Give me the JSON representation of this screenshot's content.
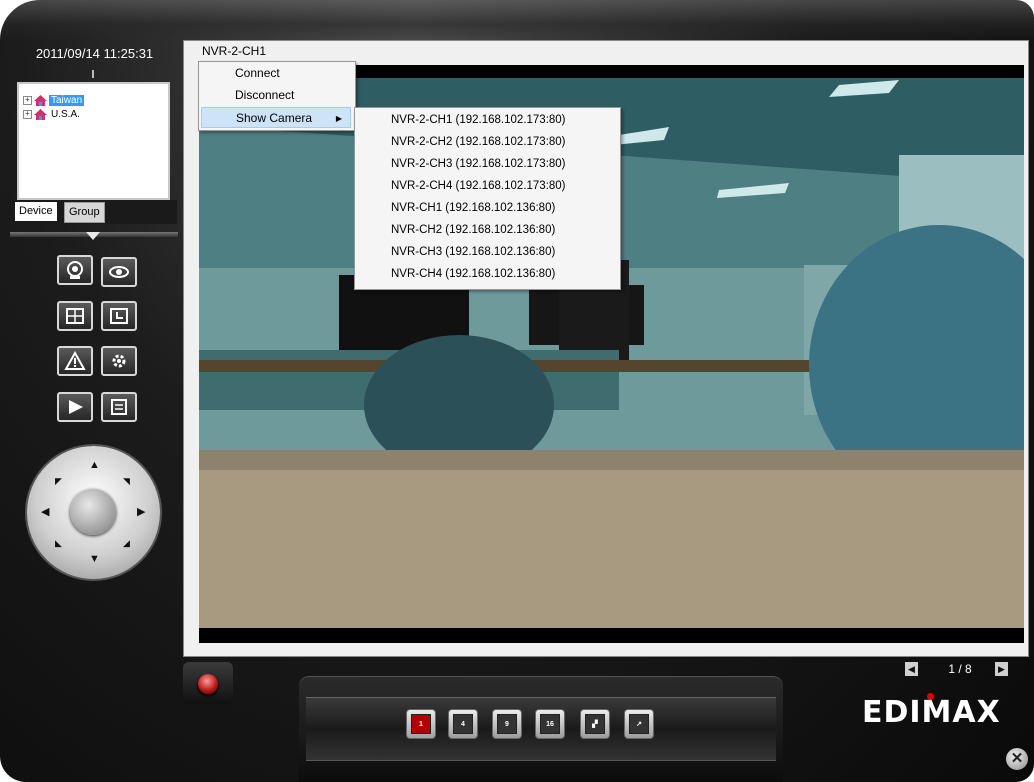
{
  "datetime": "2011/09/14 11:25:31",
  "tree": {
    "items": [
      {
        "label": "Taiwan",
        "selected": true
      },
      {
        "label": "U.S.A.",
        "selected": false
      }
    ]
  },
  "tabs": [
    "Device",
    "Group"
  ],
  "controls": {
    "buttons": [
      {
        "icon": "webcam-icon"
      },
      {
        "icon": "eye-icon"
      },
      {
        "icon": "layout-icon"
      },
      {
        "icon": "schedule-icon"
      },
      {
        "icon": "alert-icon"
      },
      {
        "icon": "settings-icon"
      },
      {
        "icon": "play-icon"
      },
      {
        "icon": "log-icon"
      }
    ]
  },
  "video": {
    "title": "NVR-2-CH1"
  },
  "context_menu": {
    "items": [
      "Connect",
      "Disconnect",
      "Show Camera"
    ],
    "submenu": [
      "NVR-2-CH1 (192.168.102.173:80)",
      "NVR-2-CH2 (192.168.102.173:80)",
      "NVR-2-CH3 (192.168.102.173:80)",
      "NVR-2-CH4 (192.168.102.173:80)",
      "NVR-CH1 (192.168.102.136:80)",
      "NVR-CH2 (192.168.102.136:80)",
      "NVR-CH3 (192.168.102.136:80)",
      "NVR-CH4 (192.168.102.136:80)"
    ]
  },
  "pager": {
    "text": "1 / 8"
  },
  "layouts": [
    {
      "label": "1",
      "selected": true
    },
    {
      "label": "4",
      "selected": false
    },
    {
      "label": "9",
      "selected": false
    },
    {
      "label": "16",
      "selected": false
    },
    {
      "label": "",
      "selected": false
    },
    {
      "label": "",
      "selected": false
    }
  ],
  "brand": "EDIMAX",
  "colors": {
    "accent": "#b10000",
    "selection": "#3399ff",
    "menu_hover": "#cde3f8"
  }
}
